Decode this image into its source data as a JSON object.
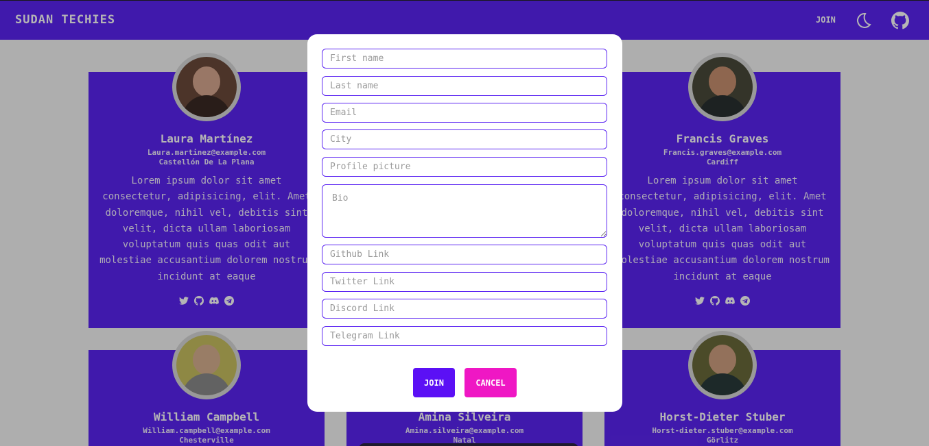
{
  "header": {
    "brand": "SUDAN TECHIES",
    "join_label": "JOIN",
    "theme_icon": "moon-icon",
    "github_icon": "github-icon"
  },
  "colors": {
    "primary": "#5b24f2",
    "join_button": "#5b10f5",
    "cancel_button": "#ef17c4",
    "modal_bg": "#ffffff"
  },
  "cards": [
    {
      "name": "Laura Martínez",
      "email": "Laura.martinez@example.com",
      "city": "Castellón De La Plana",
      "bio": "Lorem ipsum dolor sit amet consectetur, adipisicing, elit. Amet doloremque, nihil vel, debitis sint velit, dicta ullam laboriosam voluptatum quis quas odit aut molestiae accusantium dolorem nostrum incidunt at eaque"
    },
    {
      "name": "Francis Graves",
      "email": "Francis.graves@example.com",
      "city": "Cardiff",
      "bio": "Lorem ipsum dolor sit amet consectetur, adipisicing, elit. Amet doloremque, nihil vel, debitis sint velit, dicta ullam laboriosam voluptatum quis quas odit aut molestiae accusantium dolorem nostrum incidunt at eaque"
    },
    {
      "name": "William Campbell",
      "email": "William.campbell@example.com",
      "city": "Chesterville"
    },
    {
      "name": "Amina Silveira",
      "email": "Amina.silveira@example.com",
      "city": "Natal"
    },
    {
      "name": "Horst-Dieter Stuber",
      "email": "Horst-dieter.stuber@example.com",
      "city": "Görlitz"
    }
  ],
  "social_icons": [
    "twitter-icon",
    "github-icon",
    "discord-icon",
    "telegram-icon"
  ],
  "form": {
    "first_name_placeholder": "First name",
    "last_name_placeholder": "Last name",
    "email_placeholder": "Email",
    "city_placeholder": "City",
    "profile_picture_placeholder": "Profile picture",
    "bio_placeholder": "Bio",
    "github_placeholder": "Github Link",
    "twitter_placeholder": "Twitter Link",
    "discord_placeholder": "Discord Link",
    "telegram_placeholder": "Telegram Link",
    "join_label": "JOIN",
    "cancel_label": "CANCEL"
  }
}
